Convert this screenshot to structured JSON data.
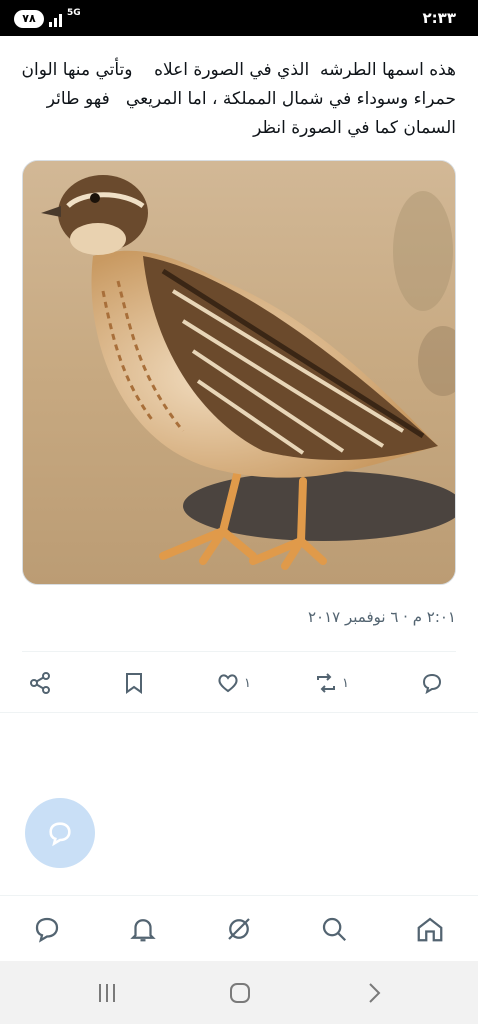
{
  "status_bar": {
    "time": "٢:٣٣",
    "battery": "٧٨",
    "network": "5G"
  },
  "tweet": {
    "text": "هذه اسمها الطرشه  الذي في الصورة اعلاه    وتأتي منها الوان حمراء وسوداء في شمال المملكة ، اما المريعي   فهو طائر السمان كما في الصورة انظر",
    "image_description_icon": "quail-photo",
    "timestamp": "٢:٠١ م · ٦ نوفمبر ٢٠١٧"
  },
  "actions": {
    "reply_count": "",
    "retweet_count": "١",
    "like_count": "١",
    "icons": [
      "reply-icon",
      "retweet-icon",
      "like-icon",
      "bookmark-icon",
      "share-icon"
    ]
  },
  "colors": {
    "accent": "#1d9bf0",
    "fab_bg": "#c9dff6",
    "icon_gray": "#536471",
    "text": "#0f1419"
  },
  "tabbar": {
    "icons": [
      "home-icon",
      "search-icon",
      "communities-icon",
      "notifications-icon",
      "messages-icon"
    ]
  },
  "system_nav": {
    "icons": [
      "recents-icon",
      "home-circle-icon",
      "back-icon"
    ]
  }
}
